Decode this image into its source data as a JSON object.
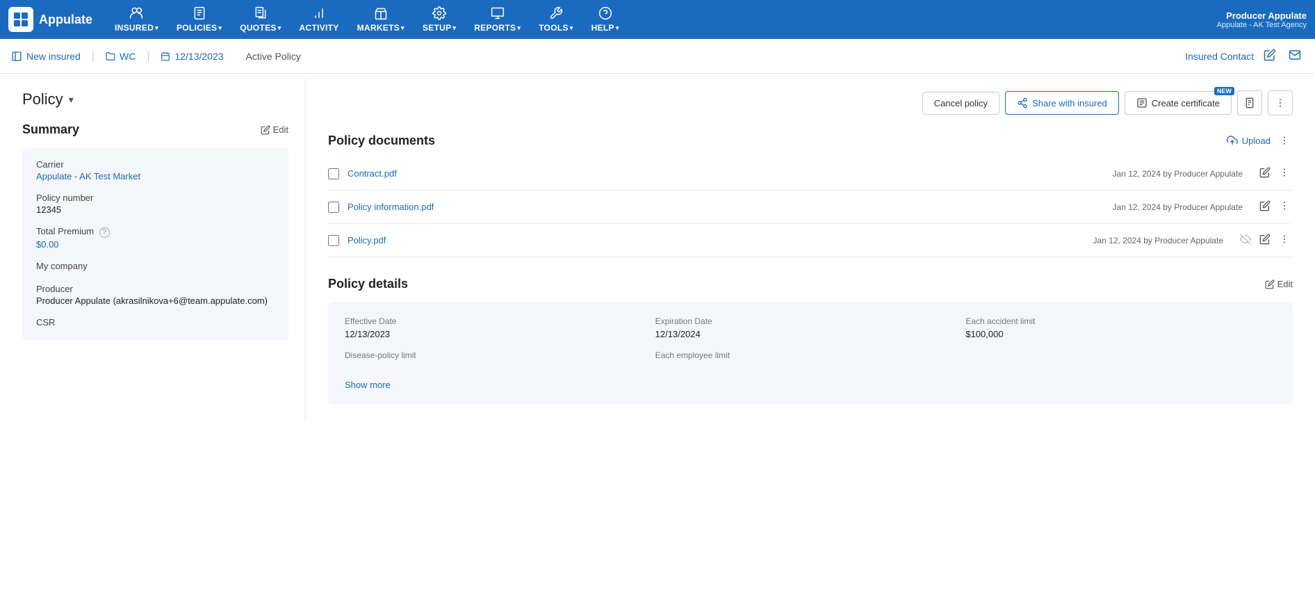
{
  "app": {
    "logo_text": "Appulate",
    "user_name": "Producer Appulate",
    "user_agency": "Appulate - AK Test Agency"
  },
  "nav": {
    "items": [
      {
        "id": "insured",
        "icon": "insured-icon",
        "label": "INSURED",
        "has_dropdown": true
      },
      {
        "id": "policies",
        "icon": "policies-icon",
        "label": "POLICIES",
        "has_dropdown": true
      },
      {
        "id": "quotes",
        "icon": "quotes-icon",
        "label": "QUOTES",
        "has_dropdown": true
      },
      {
        "id": "activity",
        "icon": "activity-icon",
        "label": "ACTIVITY",
        "has_dropdown": false
      },
      {
        "id": "markets",
        "icon": "markets-icon",
        "label": "MARKETS",
        "has_dropdown": true
      },
      {
        "id": "setup",
        "icon": "setup-icon",
        "label": "SETUP",
        "has_dropdown": true
      },
      {
        "id": "reports",
        "icon": "reports-icon",
        "label": "REPORTS",
        "has_dropdown": true
      },
      {
        "id": "tools",
        "icon": "tools-icon",
        "label": "TOOLS",
        "has_dropdown": true
      },
      {
        "id": "help",
        "icon": "help-icon",
        "label": "HELP",
        "has_dropdown": true
      }
    ]
  },
  "breadcrumb": {
    "new_insured_label": "New insured",
    "wc_label": "WC",
    "date_label": "12/13/2023",
    "status_label": "Active Policy",
    "insured_contact_label": "Insured Contact"
  },
  "policy_header": {
    "title": "Policy",
    "cancel_label": "Cancel policy",
    "share_label": "Share with insured",
    "certificate_label": "Create certificate",
    "new_badge": "NEW"
  },
  "summary": {
    "title": "Summary",
    "edit_label": "Edit",
    "carrier_label": "Carrier",
    "carrier_value": "Appulate - AK Test Market",
    "policy_number_label": "Policy number",
    "policy_number_value": "12345",
    "total_premium_label": "Total Premium",
    "total_premium_value": "$0.00",
    "company_label": "My company",
    "producer_label": "Producer",
    "producer_value": "Producer Appulate (akrasilnikova+6@team.appulate.com)",
    "csr_label": "CSR"
  },
  "documents": {
    "title": "Policy documents",
    "upload_label": "Upload",
    "items": [
      {
        "name": "Contract.pdf",
        "meta": "Jan 12, 2024 by Producer Appulate",
        "hidden": false
      },
      {
        "name": "Policy information.pdf",
        "meta": "Jan 12, 2024 by Producer Appulate",
        "hidden": false
      },
      {
        "name": "Policy.pdf",
        "meta": "Jan 12, 2024 by Producer Appulate",
        "hidden": true
      }
    ]
  },
  "policy_details": {
    "title": "Policy details",
    "edit_label": "Edit",
    "fields": [
      {
        "row": [
          {
            "label": "Effective Date",
            "value": "12/13/2023"
          },
          {
            "label": "Expiration Date",
            "value": "12/13/2024"
          },
          {
            "label": "Each accident limit",
            "value": "$100,000"
          }
        ]
      },
      {
        "row": [
          {
            "label": "Disease-policy limit",
            "value": ""
          },
          {
            "label": "Each employee limit",
            "value": ""
          },
          {
            "label": "",
            "value": ""
          }
        ]
      }
    ],
    "show_more_label": "Show more"
  }
}
